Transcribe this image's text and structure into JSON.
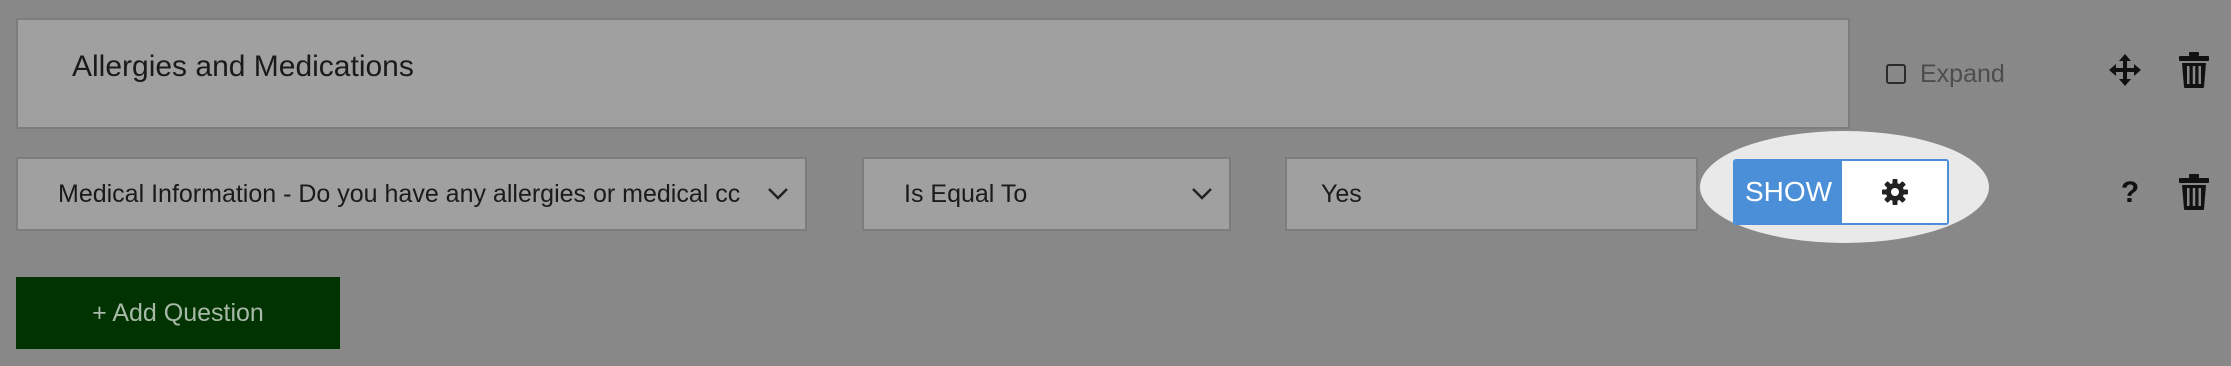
{
  "section": {
    "title": "Allergies and Medications",
    "expand_label": "Expand"
  },
  "condition": {
    "question_select_value": "Medical Information - Do you have any allergies or medical cc",
    "operator_select_value": "Is Equal To",
    "value_input": "Yes",
    "show_label": "SHOW",
    "help_label": "?"
  },
  "add_question_label": "+ Add Question",
  "icons": {
    "move": "move-arrows-icon",
    "delete": "trash-icon",
    "settings": "gear-icon",
    "dropdown": "chevron-down-icon",
    "help": "question-mark-icon"
  },
  "colors": {
    "background": "#888888",
    "field_bg": "#a0a0a0",
    "show_button": "#4a8fd8",
    "add_button": "#003300",
    "highlight": "#e9e9e9"
  }
}
